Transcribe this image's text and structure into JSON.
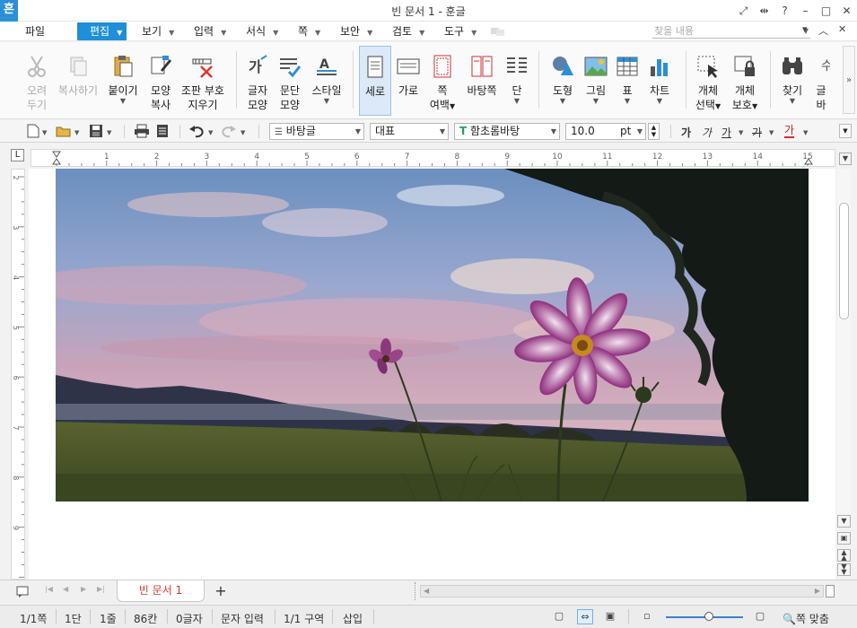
{
  "window": {
    "app_badge": "흔",
    "title": "빈 문서 1 - 훈글",
    "controls": [
      "⤢",
      "⇹",
      "?",
      "–",
      "□",
      "✕"
    ]
  },
  "menu": {
    "items": [
      "파일",
      "편집",
      "보기",
      "입력",
      "서식",
      "쪽",
      "보안",
      "검토",
      "도구"
    ],
    "active": "편집",
    "search_placeholder": "찾을 내용",
    "right_controls": [
      "▾",
      "︿",
      "✕"
    ]
  },
  "ribbon": {
    "buttons": [
      {
        "label": "오려",
        "label2": "두기",
        "icon": "scissors-icon",
        "disabled": true
      },
      {
        "label": "복사하기",
        "icon": "copy-icon",
        "disabled": true
      },
      {
        "label": "붙이기",
        "icon": "paste-icon"
      },
      {
        "label": "모양",
        "label2": "복사",
        "icon": "format-painter-icon"
      },
      {
        "label": "조판 부호",
        "label2": "지우기",
        "icon": "clear-codes-icon"
      },
      {
        "label": "글자",
        "label2": "모양",
        "icon": "char-shape-icon"
      },
      {
        "label": "문단",
        "label2": "모양",
        "icon": "para-shape-icon"
      },
      {
        "label": "스타일",
        "icon": "style-icon"
      },
      {
        "label": "세로",
        "icon": "portrait-icon",
        "selected": true
      },
      {
        "label": "가로",
        "icon": "landscape-icon"
      },
      {
        "label": "쪽",
        "label2": "여백",
        "icon": "margin-icon"
      },
      {
        "label": "바탕쪽",
        "icon": "master-page-icon"
      },
      {
        "label": "단",
        "icon": "columns-icon"
      },
      {
        "label": "도형",
        "icon": "shape-icon"
      },
      {
        "label": "그림",
        "icon": "picture-icon"
      },
      {
        "label": "표",
        "icon": "table-icon"
      },
      {
        "label": "차트",
        "icon": "chart-icon"
      },
      {
        "label": "개체",
        "label2": "선택",
        "icon": "select-object-icon"
      },
      {
        "label": "개체",
        "label2": "보호",
        "icon": "protect-object-icon"
      },
      {
        "label": "찾기",
        "icon": "binoculars-icon"
      },
      {
        "label": "글",
        "label2": "바",
        "icon": "partial-icon"
      }
    ],
    "more": "»"
  },
  "format_bar": {
    "style": "바탕글",
    "lang": "대표",
    "font": "함초롬바탕",
    "size": "10.0",
    "unit": "pt",
    "text_styles": [
      "가",
      "가",
      "가",
      "가",
      "가"
    ]
  },
  "ruler": {
    "h_numbers": [
      "1",
      "2",
      "3",
      "4",
      "5",
      "6",
      "7",
      "8",
      "9",
      "10",
      "11",
      "12",
      "13",
      "14",
      "15"
    ],
    "v_numbers": [
      "2",
      "3",
      "4",
      "5",
      "6",
      "7",
      "8",
      "9"
    ],
    "corner": "L"
  },
  "tabs": {
    "documents": [
      "빈 문서 1"
    ],
    "add": "+"
  },
  "status": {
    "page": "1/1쪽",
    "column": "1단",
    "line": "1줄",
    "col_pos": "86칸",
    "chars": "0글자",
    "input_mode": "문자 입력",
    "section": "1/1 구역",
    "insert_mode": "삽입",
    "zoom_label": "쪽 맞춤",
    "zoom_fraction": 0.5
  },
  "colors": {
    "accent": "#1e8fd8",
    "tab_text": "#d43b2c"
  }
}
